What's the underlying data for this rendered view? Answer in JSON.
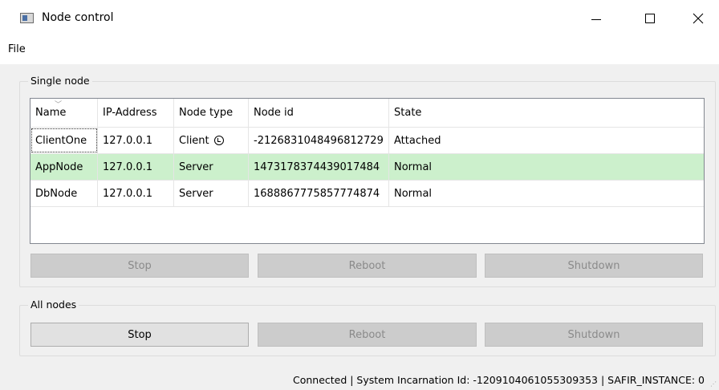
{
  "window": {
    "title": "Node control"
  },
  "menu": {
    "file": "File"
  },
  "single_node": {
    "title": "Single node",
    "columns": [
      "Name",
      "IP-Address",
      "Node type",
      "Node id",
      "State"
    ],
    "rows": [
      {
        "name": "ClientOne",
        "ip": "127.0.0.1",
        "type": "Client",
        "node_id": "-2126831048496812729",
        "state": "Attached",
        "type_icon": "lock-icon"
      },
      {
        "name": "AppNode",
        "ip": "127.0.0.1",
        "type": "Server",
        "node_id": "1473178374439017484",
        "state": "Normal",
        "selected": true
      },
      {
        "name": "DbNode",
        "ip": "127.0.0.1",
        "type": "Server",
        "node_id": "1688867775857774874",
        "state": "Normal"
      }
    ],
    "buttons": {
      "stop": "Stop",
      "reboot": "Reboot",
      "shutdown": "Shutdown"
    }
  },
  "all_nodes": {
    "title": "All nodes",
    "buttons": {
      "stop": "Stop",
      "reboot": "Reboot",
      "shutdown": "Shutdown"
    }
  },
  "status": {
    "text": "Connected | System Incarnation Id: -1209104061055309353 | SAFIR_INSTANCE: 0"
  },
  "colors": {
    "selected_row": "#ccf0cc",
    "background": "#f0f0f0"
  }
}
